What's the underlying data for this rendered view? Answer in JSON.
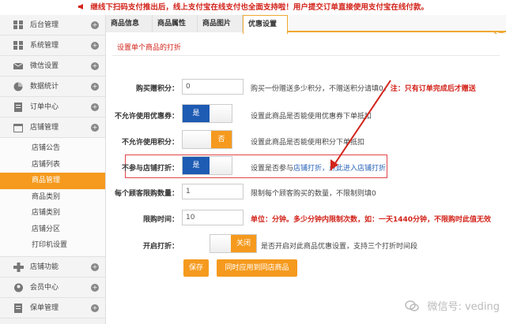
{
  "notice": {
    "text": "继线下扫码支付推出后，线上支付宝在线支付也全面支持啦！用户提交订单直接使用支付宝在线付款。",
    "close_glyph": "✕"
  },
  "sidebar": {
    "items_top": [
      {
        "label": "后台管理",
        "icon": "grid-icon"
      },
      {
        "label": "系统管理",
        "icon": "grid-icon"
      },
      {
        "label": "微信设置",
        "icon": "mail-icon"
      },
      {
        "label": "数据统计",
        "icon": "chart-icon"
      },
      {
        "label": "订单中心",
        "icon": "document-icon"
      },
      {
        "label": "店铺管理",
        "icon": "calendar-icon"
      }
    ],
    "sub_items": [
      {
        "label": "店铺公告",
        "active": false
      },
      {
        "label": "店铺列表",
        "active": false
      },
      {
        "label": "商品管理",
        "active": true
      },
      {
        "label": "商品类别",
        "active": false
      },
      {
        "label": "店铺类别",
        "active": false
      },
      {
        "label": "店铺分区",
        "active": false
      },
      {
        "label": "打印机设置",
        "active": false
      }
    ],
    "items_bottom": [
      {
        "label": "店铺功能",
        "icon": "plus-icon"
      },
      {
        "label": "会员中心",
        "icon": "user-icon"
      },
      {
        "label": "保单管理",
        "icon": "document-icon"
      }
    ],
    "plus_glyph": "+"
  },
  "tabs": [
    {
      "label": "商品信息",
      "active": false
    },
    {
      "label": "商品属性",
      "active": false
    },
    {
      "label": "商品图片",
      "active": false
    },
    {
      "label": "优惠设置",
      "active": true
    }
  ],
  "form": {
    "section_title": "设置单个商品的打折",
    "buy_points": {
      "label": "购买赠积分：",
      "value": "0",
      "hint": "购买一份赠送多少积分，不赠送积分请填0。",
      "hint_red": "注：只有订单完成后才赠送"
    },
    "no_coupon": {
      "label": "不允许使用优惠券：",
      "toggle": "是",
      "hint": "设置此商品是否能使用优惠券下单抵扣"
    },
    "no_points": {
      "label": "不允许使用积分：",
      "toggle": "否",
      "hint": "设置此商品是否能使用积分下单抵扣"
    },
    "no_discount": {
      "label": "不参与店铺打折：",
      "toggle": "是",
      "hint_prefix": "设置是否参与",
      "hint_link": "店铺打折，点此进入店铺打折"
    },
    "limit_qty": {
      "label": "每个顾客限购数量：",
      "value": "1",
      "hint": "限制每个顾客购买的数量，不限制则填0"
    },
    "limit_time": {
      "label": "限购时间：",
      "value": "10",
      "hint_red": "单位：分钟。多少分钟内限制次数，如：一天1440分钟，不限购时此值无效"
    },
    "enable_discount": {
      "label": "开启打折：",
      "toggle": "关闭",
      "hint": "是否开启对此商品优惠设置，支持三个打折时间段"
    }
  },
  "buttons": {
    "save": "保存",
    "sync": "同时应用到同店商品"
  },
  "watermark": {
    "text": "微信号: veding"
  },
  "colors": {
    "accent": "#f59a1e",
    "toggle_on": "#1e5bb3",
    "notice": "#d2231a",
    "highlight": "#e0454a"
  }
}
